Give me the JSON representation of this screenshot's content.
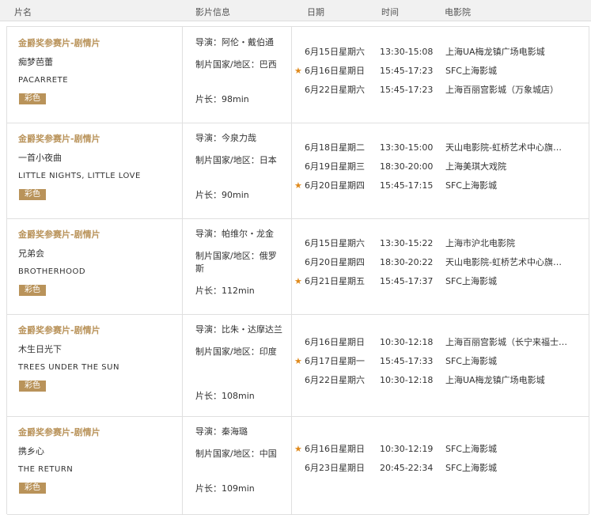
{
  "header": {
    "col_film": "片名",
    "col_info": "影片信息",
    "col_date": "日期",
    "col_time": "时间",
    "col_cinema": "电影院"
  },
  "films": [
    {
      "category": "金爵奖参赛片-剧情片",
      "title_cn": "痴梦芭蕾",
      "title_en": "PACARRETE",
      "badge": "彩色",
      "director": "导演：阿伦・戴伯通",
      "country": "制片国家/地区：巴西",
      "length": "片长：98min",
      "screenings": [
        {
          "date": "6月15日星期六",
          "time": "13:30-15:08",
          "cinema": "上海UA梅龙镇广场电影城",
          "starred": false
        },
        {
          "date": "6月16日星期日",
          "time": "15:45-17:23",
          "cinema": "SFC上海影城",
          "starred": true
        },
        {
          "date": "6月22日星期六",
          "time": "15:45-17:23",
          "cinema": "上海百丽宫影城（万象城店）",
          "starred": false
        }
      ]
    },
    {
      "category": "金爵奖参赛片-剧情片",
      "title_cn": "一首小夜曲",
      "title_en": "LITTLE NIGHTS, LITTLE LOVE",
      "badge": "彩色",
      "director": "导演：今泉力哉",
      "country": "制片国家/地区：日本",
      "length": "片长：90min",
      "screenings": [
        {
          "date": "6月18日星期二",
          "time": "13:30-15:00",
          "cinema": "天山电影院-虹桥艺术中心旗…",
          "starred": false
        },
        {
          "date": "6月19日星期三",
          "time": "18:30-20:00",
          "cinema": "上海美琪大戏院",
          "starred": false
        },
        {
          "date": "6月20日星期四",
          "time": "15:45-17:15",
          "cinema": "SFC上海影城",
          "starred": true
        }
      ]
    },
    {
      "category": "金爵奖参赛片-剧情片",
      "title_cn": "兄弟会",
      "title_en": "BROTHERHOOD",
      "badge": "彩色",
      "director": "导演：帕维尔・龙金",
      "country": "制片国家/地区：俄罗斯",
      "length": "片长：112min",
      "screenings": [
        {
          "date": "6月15日星期六",
          "time": "13:30-15:22",
          "cinema": "上海市沪北电影院",
          "starred": false
        },
        {
          "date": "6月20日星期四",
          "time": "18:30-20:22",
          "cinema": "天山电影院-虹桥艺术中心旗…",
          "starred": false
        },
        {
          "date": "6月21日星期五",
          "time": "15:45-17:37",
          "cinema": "SFC上海影城",
          "starred": true
        }
      ]
    },
    {
      "category": "金爵奖参赛片-剧情片",
      "title_cn": "木生日光下",
      "title_en": "TREES UNDER THE SUN",
      "badge": "彩色",
      "director": "导演：比朱・达摩达兰",
      "country": "制片国家/地区：印度",
      "length": "片长：108min",
      "screenings": [
        {
          "date": "6月16日星期日",
          "time": "10:30-12:18",
          "cinema": "上海百丽宫影城（长宁来福士…",
          "starred": false
        },
        {
          "date": "6月17日星期一",
          "time": "15:45-17:33",
          "cinema": "SFC上海影城",
          "starred": true
        },
        {
          "date": "6月22日星期六",
          "time": "10:30-12:18",
          "cinema": "上海UA梅龙镇广场电影城",
          "starred": false
        }
      ]
    },
    {
      "category": "金爵奖参赛片-剧情片",
      "title_cn": "携乡心",
      "title_en": "THE RETURN",
      "badge": "彩色",
      "director": "导演：秦海璐",
      "country": "制片国家/地区：中国",
      "length": "片长：109min",
      "screenings": [
        {
          "date": "6月16日星期日",
          "time": "10:30-12:19",
          "cinema": "SFC上海影城",
          "starred": true
        },
        {
          "date": "6月23日星期日",
          "time": "20:45-22:34",
          "cinema": "SFC上海影城",
          "starred": false
        }
      ]
    }
  ]
}
